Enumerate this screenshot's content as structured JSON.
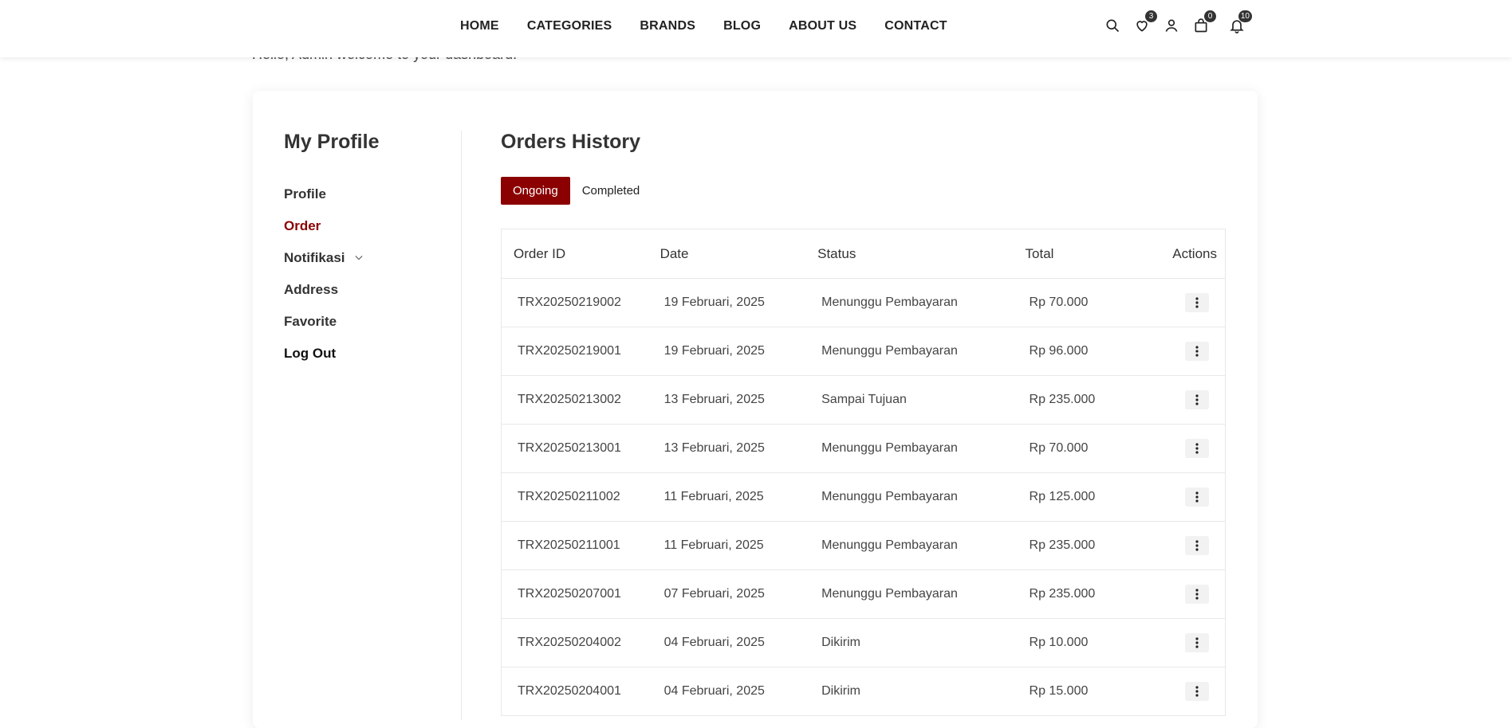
{
  "nav": {
    "items": [
      "HOME",
      "CATEGORIES",
      "BRANDS",
      "BLOG",
      "ABOUT US",
      "CONTACT"
    ]
  },
  "header_icons": {
    "wishlist_count": "3",
    "cart_count": "0",
    "notifications_count": "10"
  },
  "welcome": "Hello, Admin welcome to your dashboard!",
  "sidebar": {
    "title": "My Profile",
    "items": [
      {
        "label": "Profile"
      },
      {
        "label": "Order"
      },
      {
        "label": "Notifikasi"
      },
      {
        "label": "Address"
      },
      {
        "label": "Favorite"
      },
      {
        "label": "Log Out"
      }
    ]
  },
  "orders": {
    "title": "Orders History",
    "tabs": [
      "Ongoing",
      "Completed"
    ],
    "columns": [
      "Order ID",
      "Date",
      "Status",
      "Total",
      "Actions"
    ],
    "rows": [
      {
        "id": "TRX20250219002",
        "date": "19 Februari, 2025",
        "status": "Menunggu Pembayaran",
        "total": "Rp 70.000"
      },
      {
        "id": "TRX20250219001",
        "date": "19 Februari, 2025",
        "status": "Menunggu Pembayaran",
        "total": "Rp 96.000"
      },
      {
        "id": "TRX20250213002",
        "date": "13 Februari, 2025",
        "status": "Sampai Tujuan",
        "total": "Rp 235.000"
      },
      {
        "id": "TRX20250213001",
        "date": "13 Februari, 2025",
        "status": "Menunggu Pembayaran",
        "total": "Rp 70.000"
      },
      {
        "id": "TRX20250211002",
        "date": "11 Februari, 2025",
        "status": "Menunggu Pembayaran",
        "total": "Rp 125.000"
      },
      {
        "id": "TRX20250211001",
        "date": "11 Februari, 2025",
        "status": "Menunggu Pembayaran",
        "total": "Rp 235.000"
      },
      {
        "id": "TRX20250207001",
        "date": "07 Februari, 2025",
        "status": "Menunggu Pembayaran",
        "total": "Rp 235.000"
      },
      {
        "id": "TRX20250204002",
        "date": "04 Februari, 2025",
        "status": "Dikirim",
        "total": "Rp 10.000"
      },
      {
        "id": "TRX20250204001",
        "date": "04 Februari, 2025",
        "status": "Dikirim",
        "total": "Rp 15.000"
      }
    ]
  },
  "colors": {
    "accent": "#8b0000"
  }
}
